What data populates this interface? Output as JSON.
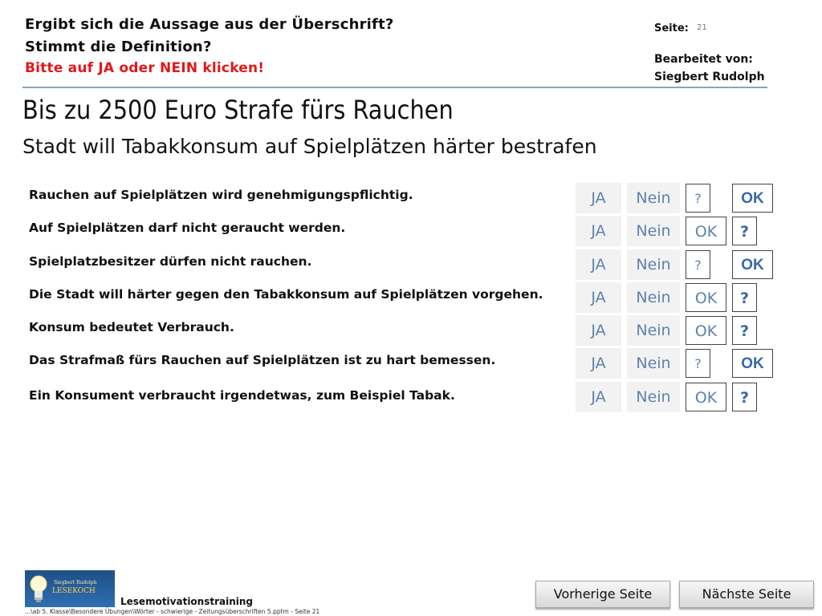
{
  "header": {
    "line1": "Ergibt sich die Aussage aus der Überschrift?",
    "line2": "Stimmt die Definition?",
    "line3": "Bitte auf JA oder NEIN klicken!",
    "seite_label": "Seite:",
    "seite_number": "21",
    "bearbeitet_label": "Bearbeitet von:",
    "bearbeitet_name": "Siegbert Rudolph"
  },
  "headline": {
    "title": "Bis zu 2500 Euro Strafe fürs Rauchen",
    "subtitle": "Stadt will Tabakkonsum auf Spielplätzen härter bestrafen"
  },
  "statements": [
    {
      "text": "Rauchen auf Spielplätzen wird genehmigungspflichtig.",
      "ja": "JA",
      "nein": "Nein",
      "box1": "?",
      "box2": "OK"
    },
    {
      "text": "Auf Spielplätzen darf nicht geraucht werden.",
      "ja": "JA",
      "nein": "Nein",
      "box1": "OK",
      "box2": "?"
    },
    {
      "text": "Spielplatzbesitzer dürfen nicht rauchen.",
      "ja": "JA",
      "nein": "Nein",
      "box1": "?",
      "box2": "OK"
    },
    {
      "text": "Die Stadt will härter gegen den Tabakkonsum auf Spielplätzen vorgehen.",
      "ja": "JA",
      "nein": "Nein",
      "box1": "OK",
      "box2": "?"
    },
    {
      "text": "Konsum bedeutet Verbrauch.",
      "ja": "JA",
      "nein": "Nein",
      "box1": "OK",
      "box2": "?"
    },
    {
      "text": "Das Strafmaß fürs Rauchen auf Spielplätzen ist zu hart bemessen.",
      "ja": "JA",
      "nein": "Nein",
      "box1": "?",
      "box2": "OK"
    },
    {
      "text": "Ein Konsument verbraucht irgendetwas, zum Beispiel Tabak.",
      "ja": "JA",
      "nein": "Nein",
      "box1": "OK",
      "box2": "?"
    }
  ],
  "logo": {
    "name": "Siegbert Rudolph",
    "brand": "LESEKOCH"
  },
  "footer": {
    "label": "Lesemotivationstraining",
    "path": "...\\ab 5. Klasse\\Besondere Übungen\\Wörter - schwierige - Zeitungsüberschriften 5.pptm - Seite 21"
  },
  "nav": {
    "prev": "Vorherige Seite",
    "next": "Nächste Seite"
  }
}
